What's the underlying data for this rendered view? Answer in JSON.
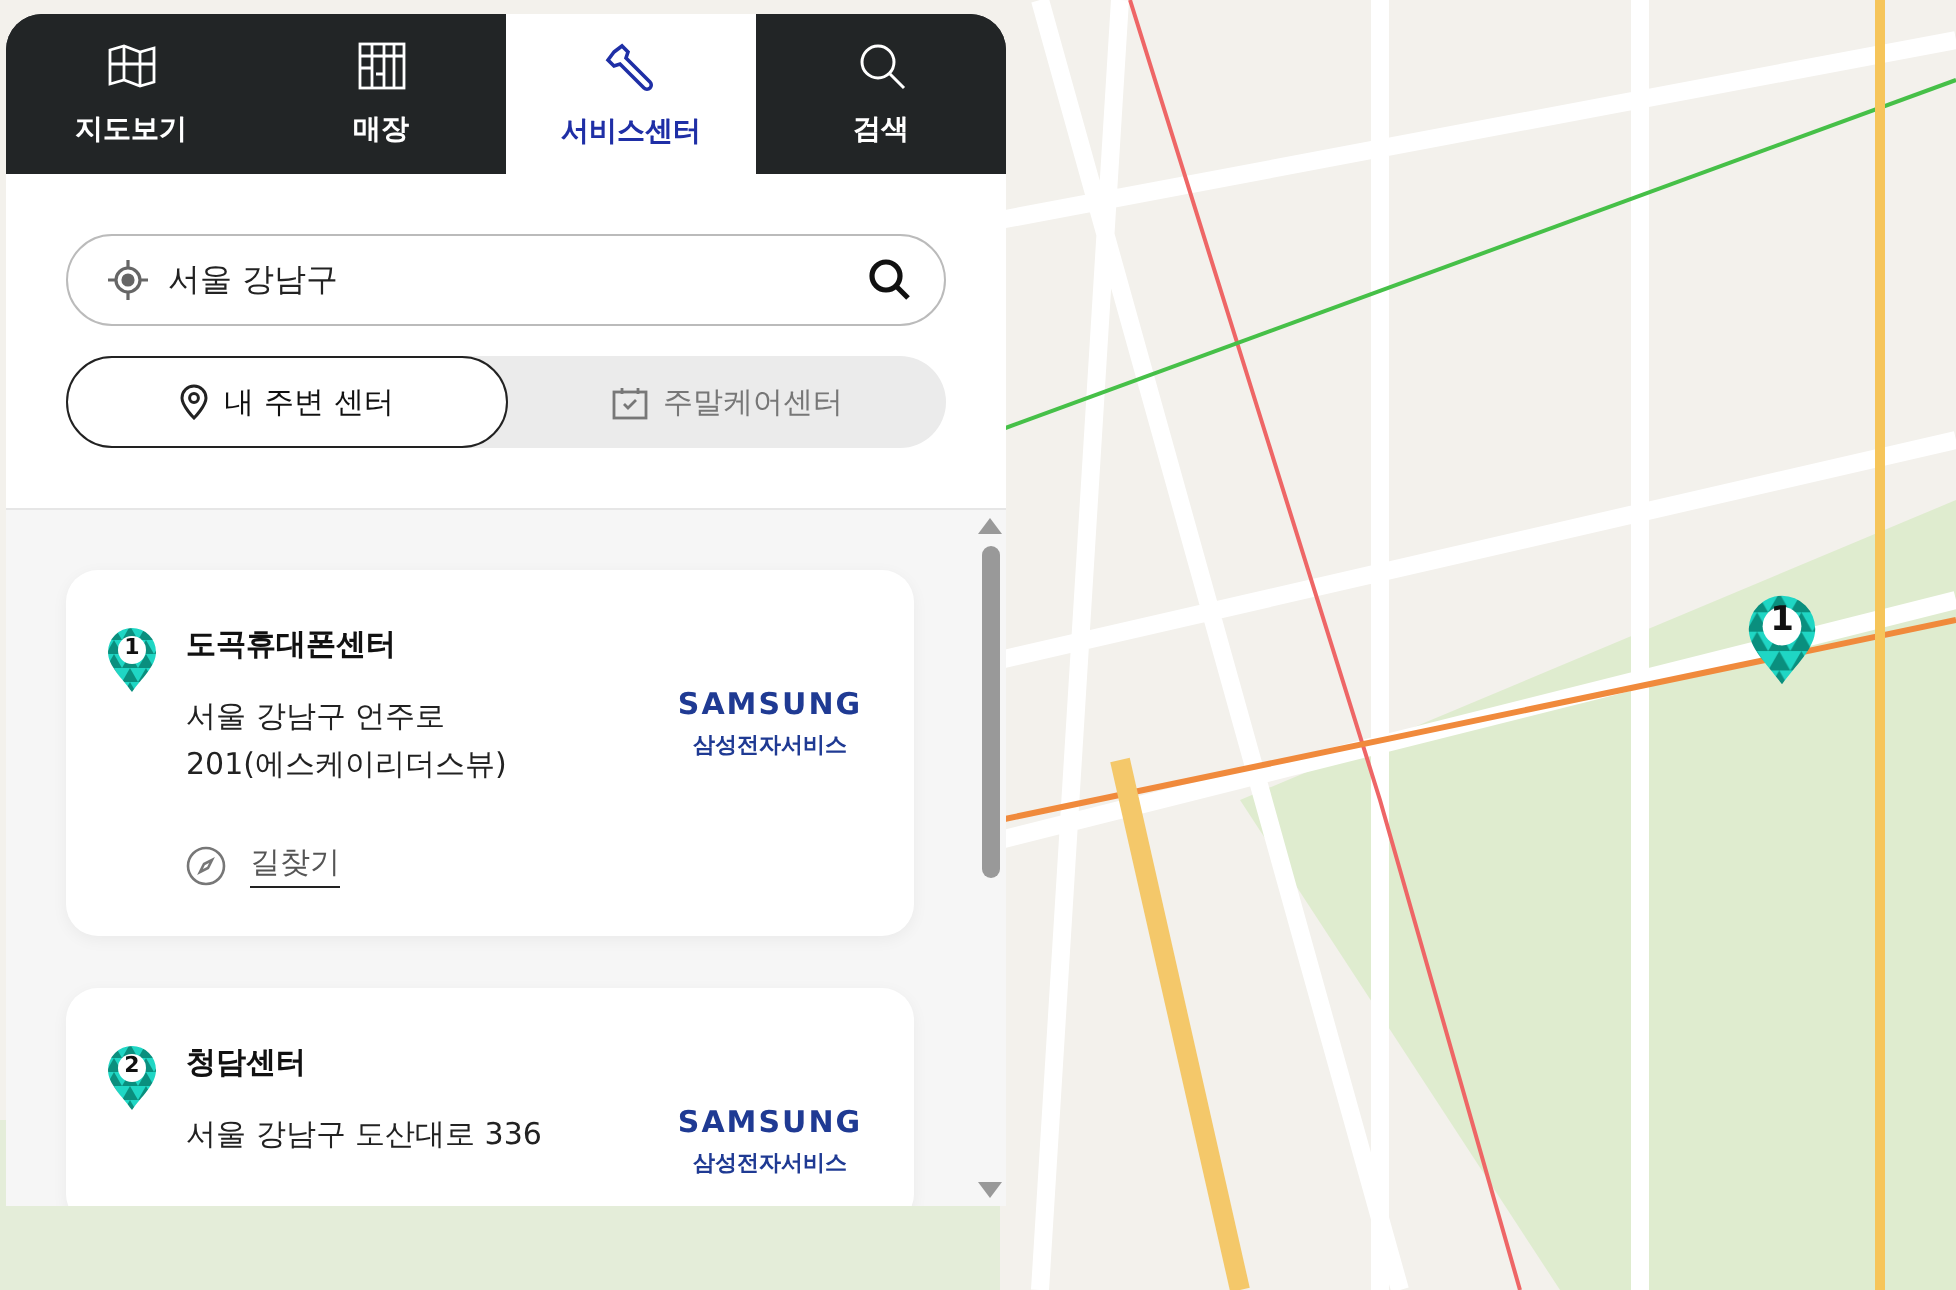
{
  "tabs": [
    {
      "label": "지도보기",
      "kind": "map",
      "selected": false
    },
    {
      "label": "매장",
      "kind": "store",
      "selected": false
    },
    {
      "label": "서비스센터",
      "kind": "wrench",
      "selected": true
    },
    {
      "label": "검색",
      "kind": "search",
      "selected": false
    }
  ],
  "search": {
    "value": "서울 강남구"
  },
  "segments": [
    {
      "label": "내 주변 센터",
      "kind": "pin",
      "selected": true
    },
    {
      "label": "주말케어센터",
      "kind": "calendar",
      "selected": false
    }
  ],
  "centers": [
    {
      "number": "1",
      "name": "도곡휴대폰센터",
      "address": "서울 강남구 언주로 201(에스케이리더스뷰)",
      "logo": {
        "brand": "SAMSUNG",
        "subtitle": "삼성전자서비스"
      },
      "directions": "길찾기"
    },
    {
      "number": "2",
      "name": "청담센터",
      "address": "서울 강남구 도산대로 336",
      "logo": {
        "brand": "SAMSUNG",
        "subtitle": "삼성전자서비스"
      }
    }
  ],
  "map": {
    "marker": "1"
  }
}
